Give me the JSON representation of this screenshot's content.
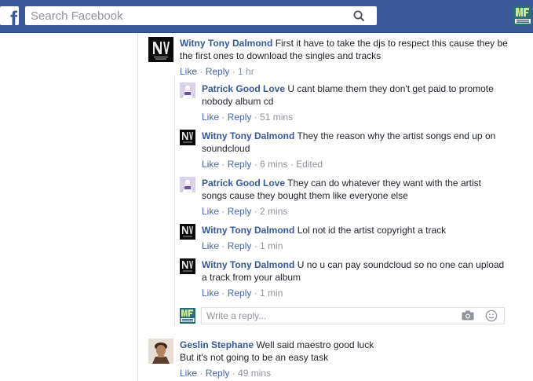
{
  "header": {
    "logo_letter": "f",
    "search_placeholder": "Search Facebook",
    "icons": {
      "logo": "facebook-logo-icon",
      "search": "search-icon",
      "avatar": "profile-avatar"
    }
  },
  "comments": [
    {
      "author": "Witny Tony Dalmond",
      "text": "First it have to take the djs to respect this cause they be the first ones to download the singles and tracks",
      "like": "Like",
      "reply": "Reply",
      "time": "1 hr"
    },
    {
      "author": "Geslin Stephane",
      "text_line1": "Well said maestro good luck",
      "text_line2": "But it's not going to be an easy task",
      "like": "Like",
      "reply": "Reply",
      "time": "49 mins"
    }
  ],
  "replies": [
    {
      "author": "Patrick Good Love",
      "text": "U cant blame them they don't get paid to promote nobody album cd",
      "like": "Like",
      "reply": "Reply",
      "time": "51 mins",
      "edited": ""
    },
    {
      "author": "Witny Tony Dalmond",
      "text": "They the reason why the artist songs end up on soundcloud",
      "like": "Like",
      "reply": "Reply",
      "time": "6 mins",
      "edited": "Edited"
    },
    {
      "author": "Patrick Good Love",
      "text": "They can do whatever they want with the artist songs cause they bought them like everyone else",
      "like": "Like",
      "reply": "Reply",
      "time": "2 mins",
      "edited": ""
    },
    {
      "author": "Witny Tony Dalmond",
      "text": "Lol not id the artist copyright a track",
      "like": "Like",
      "reply": "Reply",
      "time": "1 min",
      "edited": ""
    },
    {
      "author": "Witny Tony Dalmond",
      "text": "U no u can pay soundcloud so no one can upload a track from your album",
      "like": "Like",
      "reply": "Reply",
      "time": "1 min",
      "edited": ""
    }
  ],
  "reply_box": {
    "placeholder": "Write a reply...",
    "icons": {
      "camera": "camera-icon",
      "emoji": "emoji-icon"
    }
  },
  "colors": {
    "brand": "#3b5998",
    "author_link": "#365899",
    "action_link": "#4267b2",
    "meta": "#90949c"
  }
}
